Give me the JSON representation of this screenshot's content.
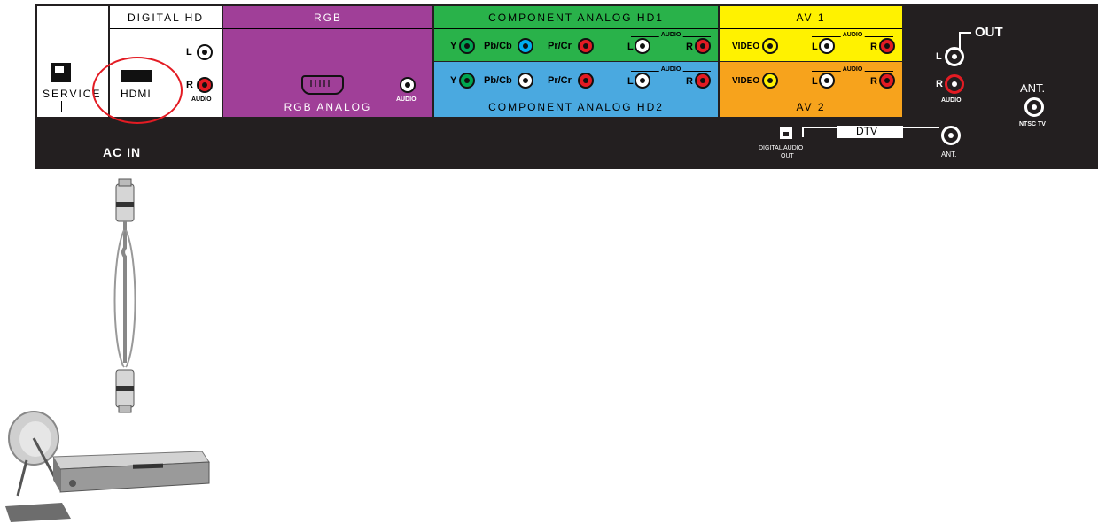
{
  "panel": {
    "service_label": "SERVICE",
    "digital_hd": {
      "header": "DIGITAL HD",
      "hdmi_label": "HDMI",
      "left_label": "L",
      "right_label": "R",
      "audio_label": "AUDIO"
    },
    "rgb": {
      "header": "RGB",
      "footer": "RGB ANALOG",
      "audio_label": "AUDIO"
    },
    "component1": {
      "header": "COMPONENT ANALOG HD1",
      "y_label": "Y",
      "pb_label": "Pb/Cb",
      "pr_label": "Pr/Cr",
      "audio_label": "AUDIO",
      "left_label": "L",
      "right_label": "R"
    },
    "component2": {
      "footer": "COMPONENT ANALOG HD2",
      "y_label": "Y",
      "pb_label": "Pb/Cb",
      "pr_label": "Pr/Cr",
      "audio_label": "AUDIO",
      "left_label": "L",
      "right_label": "R"
    },
    "av1": {
      "header": "AV 1",
      "video_label": "VIDEO",
      "audio_label": "AUDIO",
      "left_label": "L",
      "right_label": "R"
    },
    "av2": {
      "footer": "AV 2",
      "video_label": "VIDEO",
      "audio_label": "AUDIO",
      "left_label": "L",
      "right_label": "R"
    },
    "out": {
      "title": "OUT",
      "left_label": "L",
      "right_label": "R",
      "audio_label": "AUDIO"
    },
    "antenna": {
      "label": "ANT.",
      "sub_label": "NTSC TV"
    },
    "bottom": {
      "ac_in": "AC IN",
      "digital_audio_line1": "DIGITAL AUDIO",
      "digital_audio_line2": "OUT",
      "dtv_label": "DTV",
      "ant_label": "ANT."
    }
  },
  "colors": {
    "panel": "#231f20",
    "rgb_section": "#a03f98",
    "component1_section": "#29b24a",
    "component2_section": "#4aa9e0",
    "av1_section": "#fff200",
    "av2_section": "#f7a31c",
    "highlight_circle": "#e31b23"
  }
}
